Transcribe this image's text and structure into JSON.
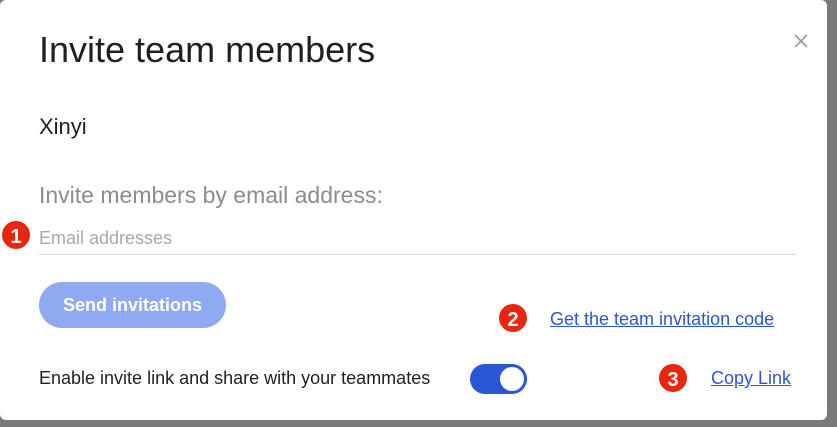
{
  "dialog": {
    "title": "Invite team members",
    "team_name": "Xinyi",
    "section_label": "Invite members by email address:",
    "email_input": {
      "placeholder": "Email addresses",
      "value": ""
    },
    "send_button_label": "Send invitations",
    "invitation_code_link": "Get the team invitation code",
    "invite_link_toggle": {
      "label": "Enable invite link and share with your teammates",
      "enabled": true
    },
    "copy_link_label": "Copy Link",
    "close_icon": "close-icon"
  },
  "annotations": [
    "1",
    "2",
    "3"
  ],
  "colors": {
    "primary": "#2a57d6",
    "button_disabled": "#8fa9f2",
    "link": "#2f55d4",
    "marker": "#e8260f"
  }
}
